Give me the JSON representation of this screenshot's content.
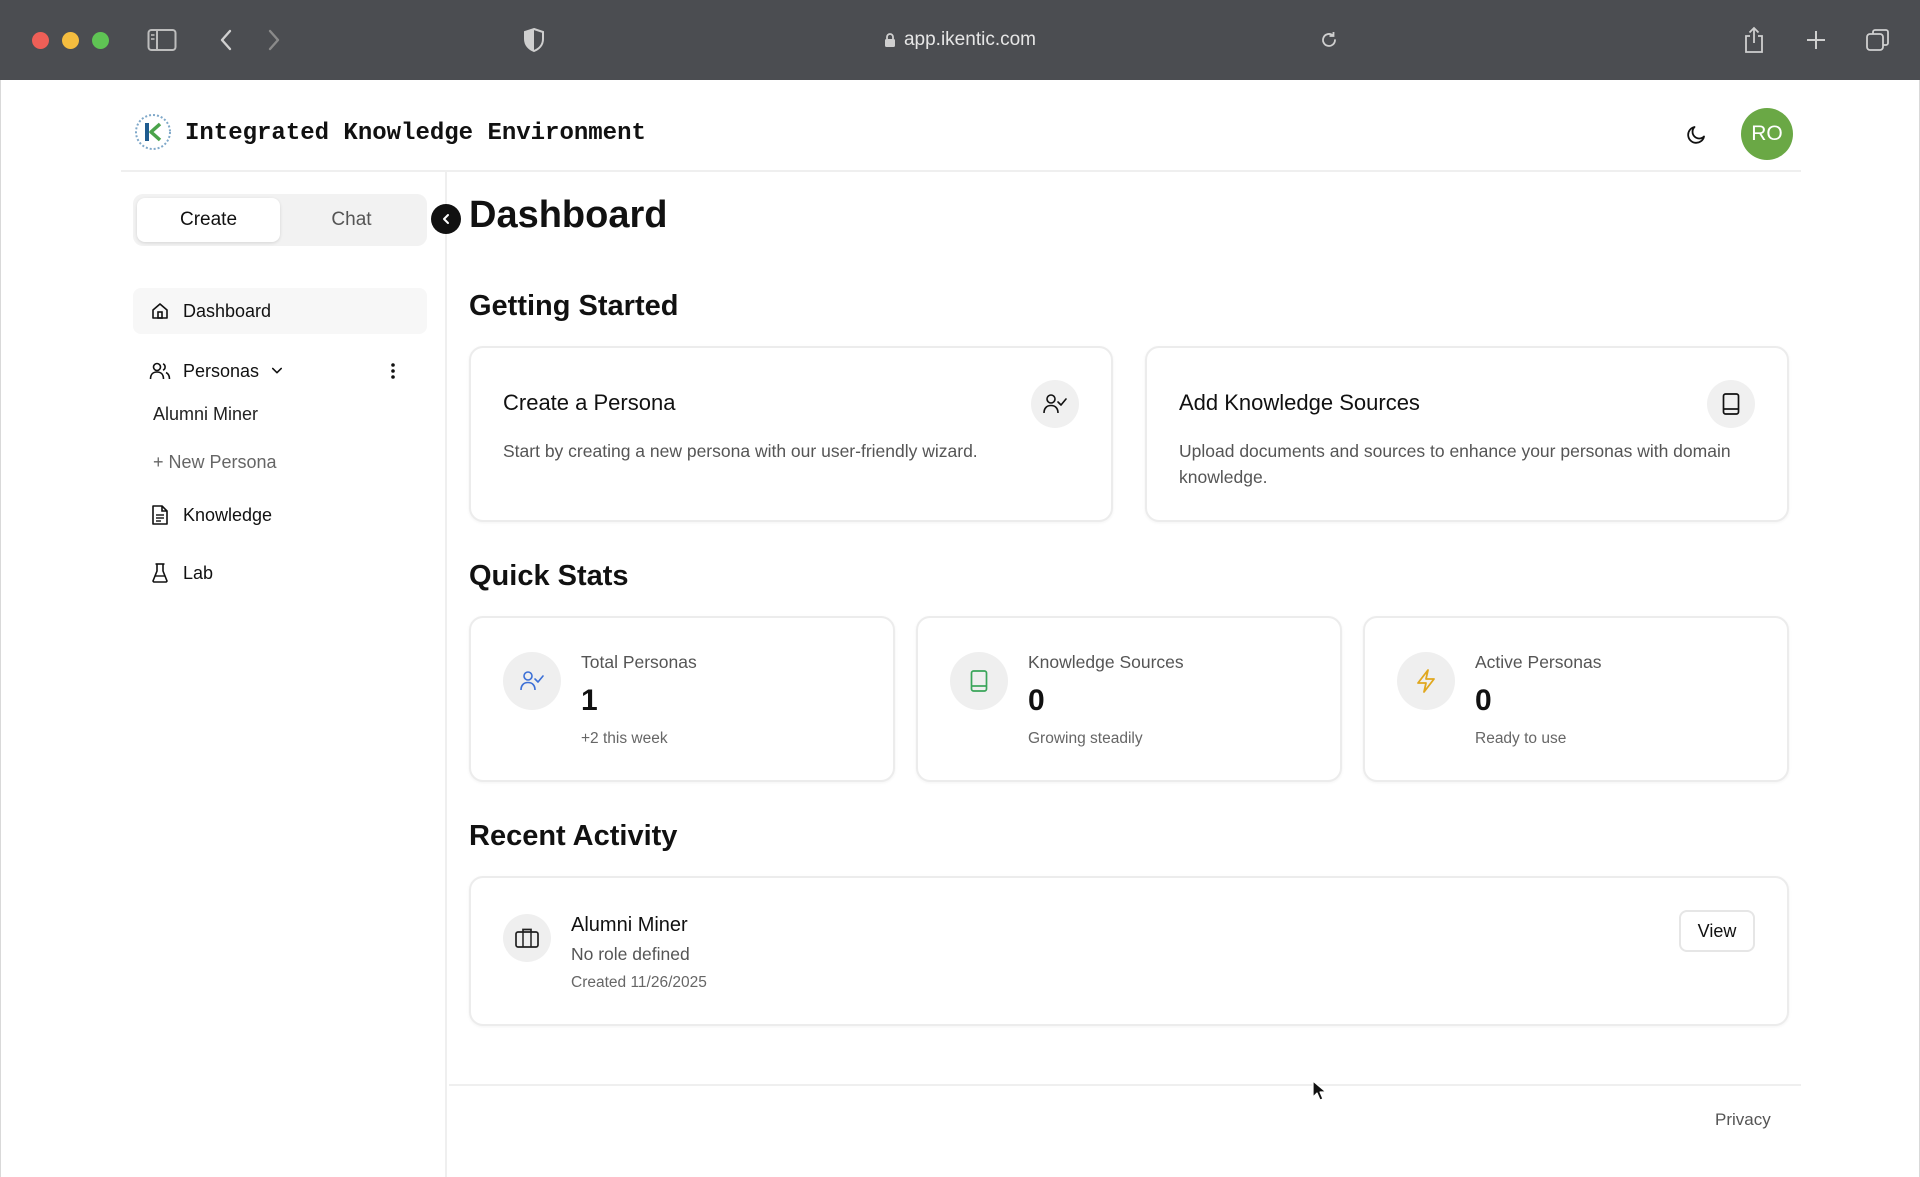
{
  "browser": {
    "url": "app.ikentic.com",
    "icons": [
      "sidebar-icon",
      "back-icon",
      "forward-icon",
      "shield-icon",
      "lock-icon",
      "reload-icon",
      "share-icon",
      "new-tab-icon",
      "tabs-icon"
    ]
  },
  "header": {
    "app_title": "Integrated Knowledge Environment",
    "avatar_initials": "RO",
    "avatar_color": "#6aa845"
  },
  "sidebar": {
    "modes": [
      "Create",
      "Chat"
    ],
    "active_mode": "Create",
    "dashboard": "Dashboard",
    "personas": "Personas",
    "persona_items": [
      "Alumni Miner"
    ],
    "new_persona": "+ New Persona",
    "knowledge": "Knowledge",
    "lab": "Lab"
  },
  "main": {
    "title": "Dashboard",
    "getting_started": {
      "heading": "Getting Started",
      "cards": [
        {
          "title": "Create a Persona",
          "desc": "Start by creating a new persona with our user-friendly wizard.",
          "icon": "user-check-icon"
        },
        {
          "title": "Add Knowledge Sources",
          "desc": "Upload documents and sources to enhance your personas with domain knowledge.",
          "icon": "book-icon"
        }
      ]
    },
    "quick_stats": {
      "heading": "Quick Stats",
      "stats": [
        {
          "label": "Total Personas",
          "value": "1",
          "sub": "+2 this week",
          "icon": "user-check-icon",
          "color": "#3b6fd6"
        },
        {
          "label": "Knowledge Sources",
          "value": "0",
          "sub": "Growing steadily",
          "icon": "book-icon",
          "color": "#3aa55a"
        },
        {
          "label": "Active Personas",
          "value": "0",
          "sub": "Ready to use",
          "icon": "zap-icon",
          "color": "#e0a71e"
        }
      ]
    },
    "recent_activity": {
      "heading": "Recent Activity",
      "items": [
        {
          "name": "Alumni Miner",
          "role": "No role defined",
          "date": "Created 11/26/2025",
          "action": "View"
        }
      ]
    }
  },
  "footer": {
    "privacy": "Privacy"
  }
}
